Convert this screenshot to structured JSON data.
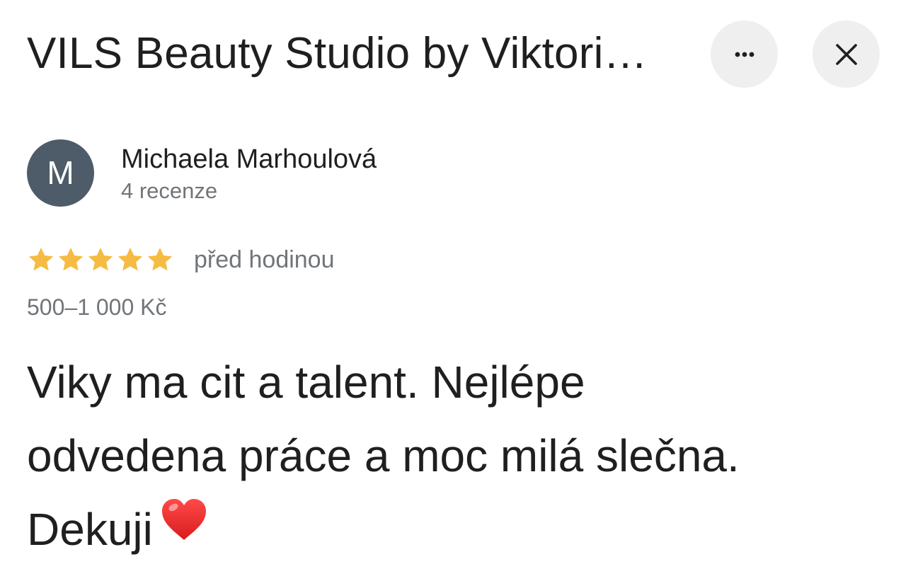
{
  "header": {
    "title": "VILS Beauty Studio by Viktori…",
    "more_icon": "more-horizontal-icon",
    "close_icon": "close-icon"
  },
  "review": {
    "author": {
      "initial": "M",
      "name": "Michaela Marhoulová",
      "review_count": "4 recenze",
      "avatar_color": "#4d5c68"
    },
    "rating": 5,
    "rating_max": 5,
    "star_color": "#f6bb42",
    "time_ago": "před hodinou",
    "price_range": "500–1 000 Kč",
    "text_lines": [
      "Viky ma cit a talent. Nejlépe",
      "odvedena práce a moc milá slečna.",
      "Dekuji"
    ],
    "emoji": "heart-emoji-icon"
  }
}
